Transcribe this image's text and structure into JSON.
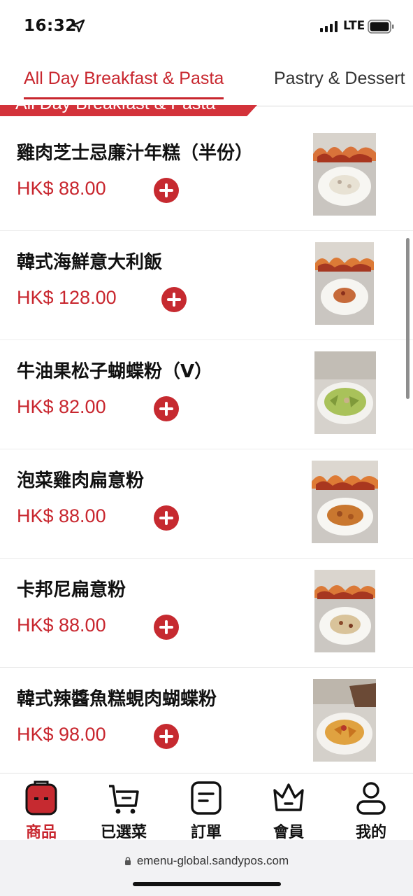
{
  "status": {
    "time": "16:32",
    "network": "LTE"
  },
  "tabs": [
    {
      "label": "All Day Breakfast & Pasta",
      "active": true
    },
    {
      "label": "Pastry & Dessert",
      "active": false
    }
  ],
  "section_title": "All Day Breakfast & Pasta",
  "items": [
    {
      "name": "雞肉芝士忌廉汁年糕（半份）",
      "price": "HK$ 88.00"
    },
    {
      "name": "韓式海鮮意大利飯",
      "price": "HK$ 128.00"
    },
    {
      "name": "牛油果松子蝴蝶粉（V）",
      "price": "HK$ 82.00"
    },
    {
      "name": "泡菜雞肉扁意粉",
      "price": "HK$ 88.00"
    },
    {
      "name": "卡邦尼扁意粉",
      "price": "HK$ 88.00"
    },
    {
      "name": "韓式辣醬魚糕蜆肉蝴蝶粉",
      "price": "HK$ 98.00"
    }
  ],
  "nav": [
    {
      "label": "商品",
      "icon": "product-icon",
      "active": true
    },
    {
      "label": "已選菜",
      "icon": "cart-icon",
      "active": false
    },
    {
      "label": "訂單",
      "icon": "order-icon",
      "active": false
    },
    {
      "label": "會員",
      "icon": "crown-icon",
      "active": false
    },
    {
      "label": "我的",
      "icon": "person-icon",
      "active": false
    }
  ],
  "browser": {
    "url": "emenu-global.sandypos.com"
  },
  "colors": {
    "accent": "#c8262e",
    "text": "#111111"
  }
}
